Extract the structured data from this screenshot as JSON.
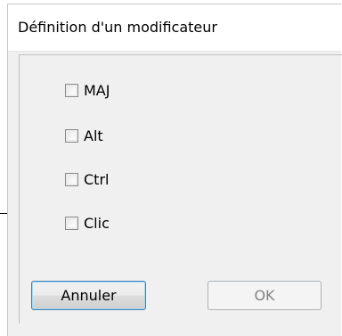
{
  "dialog": {
    "title": "Définition d'un modificateur"
  },
  "options": [
    {
      "label": "MAJ",
      "checked": false
    },
    {
      "label": "Alt",
      "checked": false
    },
    {
      "label": "Ctrl",
      "checked": false
    },
    {
      "label": "Clic",
      "checked": false
    }
  ],
  "buttons": {
    "cancel_label": "Annuler",
    "ok_label": "OK",
    "ok_enabled": false
  }
}
